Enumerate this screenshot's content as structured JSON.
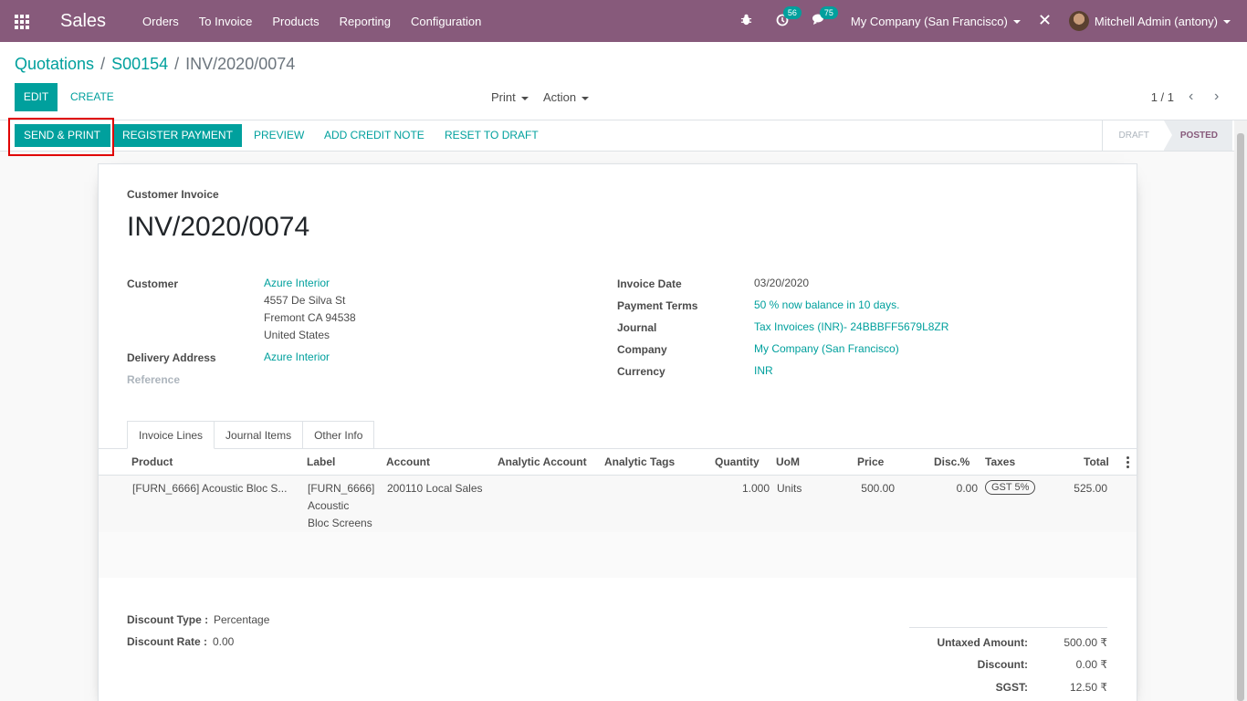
{
  "navbar": {
    "brand": "Sales",
    "menu": [
      "Orders",
      "To Invoice",
      "Products",
      "Reporting",
      "Configuration"
    ],
    "activities_count": "56",
    "messages_count": "75",
    "company": "My Company (San Francisco)",
    "user": "Mitchell Admin (antony)",
    "icons": [
      "apps-icon",
      "bug-icon",
      "clock-icon",
      "chat-icon",
      "tools-icon"
    ]
  },
  "control_panel": {
    "breadcrumb": [
      "Quotations",
      "S00154",
      "INV/2020/0074"
    ],
    "edit_label": "EDIT",
    "create_label": "CREATE",
    "print_label": "Print",
    "action_label": "Action",
    "pager": "1 / 1"
  },
  "statusbar": {
    "buttons": [
      "SEND & PRINT",
      "REGISTER PAYMENT",
      "PREVIEW",
      "ADD CREDIT NOTE",
      "RESET TO DRAFT"
    ],
    "states": [
      "DRAFT",
      "POSTED"
    ],
    "active_state": "POSTED"
  },
  "invoice": {
    "doc_type": "Customer Invoice",
    "name": "INV/2020/0074",
    "customer_label": "Customer",
    "customer_name": "Azure Interior",
    "customer_address": [
      "4557 De Silva St",
      "Fremont CA 94538",
      "United States"
    ],
    "delivery_label": "Delivery Address",
    "delivery_value": "Azure Interior",
    "reference_label": "Reference",
    "invoice_date_label": "Invoice Date",
    "invoice_date": "03/20/2020",
    "payment_terms_label": "Payment Terms",
    "payment_terms": "50 % now balance in 10 days.",
    "journal_label": "Journal",
    "journal": "Tax Invoices (INR)- 24BBBFF5679L8ZR",
    "company_label": "Company",
    "company": "My Company (San Francisco)",
    "currency_label": "Currency",
    "currency": "INR"
  },
  "tabs": [
    "Invoice Lines",
    "Journal Items",
    "Other Info"
  ],
  "lines": {
    "headers": [
      "Product",
      "Label",
      "Account",
      "Analytic Account",
      "Analytic Tags",
      "Quantity",
      "UoM",
      "Price",
      "Disc.%",
      "Taxes",
      "Total"
    ],
    "rows": [
      {
        "product": "[FURN_6666] Acoustic Bloc S...",
        "label": [
          "[FURN_6666]",
          "Acoustic",
          "Bloc Screens"
        ],
        "account": "200110 Local Sales",
        "quantity": "1.000",
        "uom": "Units",
        "price": "500.00",
        "discount": "0.00",
        "tax": "GST 5%",
        "total": "525.00"
      }
    ]
  },
  "discount": {
    "type_label": "Discount Type :",
    "type_value": "Percentage",
    "rate_label": "Discount Rate :",
    "rate_value": "0.00"
  },
  "totals": [
    {
      "label": "Untaxed Amount:",
      "value": "500.00 ₹"
    },
    {
      "label": "Discount:",
      "value": "0.00 ₹"
    },
    {
      "label": "SGST:",
      "value": "12.50 ₹"
    }
  ],
  "colors": {
    "primary": "#875a7b",
    "accent": "#00a09d",
    "highlight": "#e00000"
  }
}
